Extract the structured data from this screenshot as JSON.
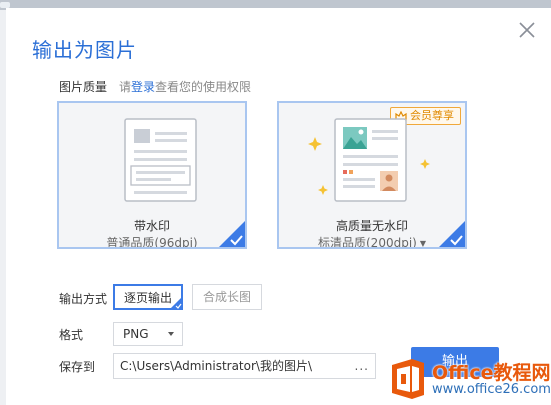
{
  "dialog": {
    "title": "输出为图片"
  },
  "quality": {
    "label": "图片质量",
    "hint_prefix": "请",
    "hint_link": "登录",
    "hint_suffix": "查看您的使用权限"
  },
  "cards": [
    {
      "name": "带水印",
      "sub": "普通品质(96dpi)",
      "selected": true
    },
    {
      "name": "高质量无水印",
      "sub": "标清品质(200dpi)",
      "badge": "会员尊享",
      "selected": true
    }
  ],
  "output_mode": {
    "label": "输出方式",
    "options": [
      "逐页输出",
      "合成长图"
    ],
    "selected": "逐页输出"
  },
  "format": {
    "label": "格式",
    "value": "PNG"
  },
  "save_to": {
    "label": "保存到",
    "path": "C:\\Users\\Administrator\\我的图片\\",
    "browse": "..."
  },
  "export_label": "输出",
  "watermark": {
    "brand": "Office教程网",
    "url": "www.office26.com"
  },
  "colors": {
    "accent": "#3c7be6",
    "title": "#2b6fd6",
    "vip": "#f0a83a",
    "brand": "#e8590c"
  },
  "icons": [
    "close-icon",
    "check-corner-icon",
    "crown-icon",
    "dropdown-arrow-icon",
    "office-logo-icon"
  ]
}
